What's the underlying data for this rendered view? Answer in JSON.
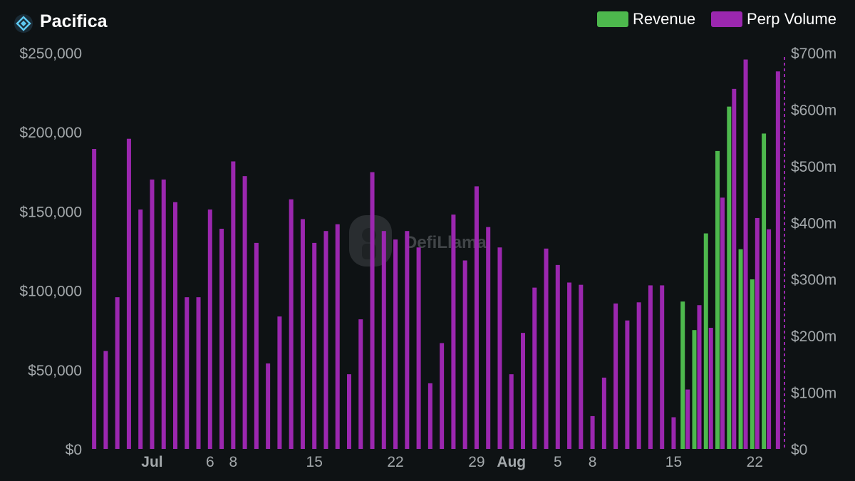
{
  "header": {
    "title": "Pacifica",
    "logo_icon": "pacifica-logo-icon"
  },
  "legend": {
    "revenue_label": "Revenue",
    "perp_label": "Perp Volume",
    "revenue_color": "#4db84d",
    "perp_color": "#9b27af"
  },
  "watermark": "DefiLlama",
  "chart_data": {
    "type": "bar",
    "title": "",
    "legend_position": "top-right",
    "grid": false,
    "x_ticks": [
      {
        "label": "Jul",
        "index": 5,
        "bold": true
      },
      {
        "label": "6",
        "index": 10,
        "bold": false
      },
      {
        "label": "8",
        "index": 12,
        "bold": false
      },
      {
        "label": "15",
        "index": 19,
        "bold": false
      },
      {
        "label": "22",
        "index": 26,
        "bold": false
      },
      {
        "label": "29",
        "index": 33,
        "bold": false
      },
      {
        "label": "Aug",
        "index": 36,
        "bold": true
      },
      {
        "label": "5",
        "index": 40,
        "bold": false
      },
      {
        "label": "8",
        "index": 43,
        "bold": false
      },
      {
        "label": "15",
        "index": 50,
        "bold": false
      },
      {
        "label": "22",
        "index": 57,
        "bold": false
      }
    ],
    "y_left": {
      "label": "",
      "ticks": [
        "$0",
        "$50,000",
        "$100,000",
        "$150,000",
        "$200,000",
        "$250,000"
      ],
      "range": [
        0,
        250000
      ]
    },
    "y_right": {
      "label": "",
      "ticks": [
        "$0",
        "$100m",
        "$200m",
        "$300m",
        "$400m",
        "$500m",
        "$600m",
        "$700m"
      ],
      "range": [
        0,
        700
      ]
    },
    "series": [
      {
        "name": "Revenue",
        "axis": "left",
        "color": "#4db84d",
        "values": [
          0,
          0,
          0,
          0,
          0,
          0,
          0,
          0,
          0,
          0,
          0,
          0,
          0,
          0,
          0,
          0,
          0,
          0,
          0,
          0,
          0,
          0,
          0,
          0,
          0,
          0,
          0,
          0,
          0,
          0,
          0,
          0,
          0,
          0,
          0,
          0,
          0,
          0,
          0,
          0,
          0,
          0,
          0,
          0,
          0,
          0,
          0,
          0,
          0,
          0,
          0,
          93000,
          75000,
          136000,
          188000,
          216000,
          126000,
          107000,
          199000
        ]
      },
      {
        "name": "Perp Volume",
        "axis": "right",
        "color": "#9b27af",
        "values": [
          530,
          173,
          268,
          548,
          423,
          476,
          476,
          436,
          268,
          268,
          423,
          389,
          508,
          482,
          364,
          151,
          234,
          441,
          406,
          364,
          385,
          397,
          132,
          229,
          489,
          385,
          370,
          385,
          356,
          116,
          187,
          414,
          333,
          464,
          392,
          356,
          132,
          205,
          285,
          354,
          325,
          294,
          290,
          58,
          126,
          257,
          227,
          259,
          289,
          289,
          56,
          105,
          254,
          214,
          444,
          636,
          688,
          408,
          388,
          667
        ]
      }
    ]
  }
}
